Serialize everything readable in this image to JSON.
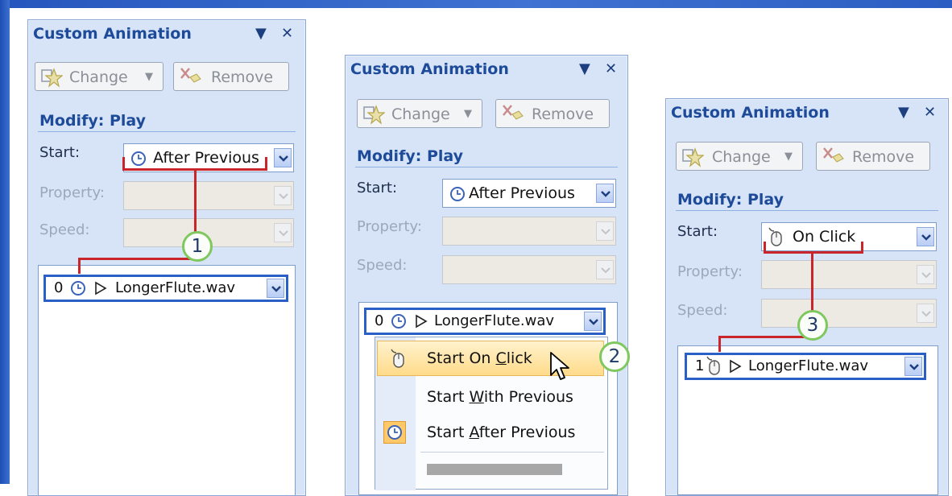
{
  "panels": [
    {
      "title": "Custom Animation",
      "controls": {
        "dropdown": "▼",
        "close": "✕"
      },
      "buttons": {
        "change": "Change",
        "remove": "Remove"
      },
      "section_title": "Modify: Play",
      "labels": {
        "start": "Start:",
        "property": "Property:",
        "speed": "Speed:"
      },
      "start_value": "After Previous",
      "item": {
        "index": "0",
        "name": "LongerFlute.wav"
      }
    },
    {
      "title": "Custom Animation",
      "controls": {
        "dropdown": "▼",
        "close": "✕"
      },
      "buttons": {
        "change": "Change",
        "remove": "Remove"
      },
      "section_title": "Modify: Play",
      "labels": {
        "start": "Start:",
        "property": "Property:",
        "speed": "Speed:"
      },
      "start_value": "After Previous",
      "item": {
        "index": "0",
        "name": "LongerFlute.wav"
      }
    },
    {
      "title": "Custom Animation",
      "controls": {
        "dropdown": "▼",
        "close": "✕"
      },
      "buttons": {
        "change": "Change",
        "remove": "Remove"
      },
      "section_title": "Modify: Play",
      "labels": {
        "start": "Start:",
        "property": "Property:",
        "speed": "Speed:"
      },
      "start_value": "On Click",
      "item": {
        "index": "1",
        "name": "LongerFlute.wav"
      }
    }
  ],
  "context_menu": {
    "items": [
      "Start On Click",
      "Start With Previous",
      "Start After Previous"
    ],
    "accelerators": [
      "C",
      "W",
      "A"
    ],
    "highlighted": "Start On Click"
  },
  "callouts": [
    "1",
    "2",
    "3"
  ],
  "colors": {
    "highlight": "#c9262c",
    "selection": "#2a5fc6",
    "badge_ring": "#7ec85e",
    "title_text": "#1d4b9a"
  },
  "icons": [
    "clock-icon",
    "mouse-icon",
    "play-triangle-icon",
    "change-star-icon",
    "remove-icon",
    "mouse-pointer-icon"
  ]
}
